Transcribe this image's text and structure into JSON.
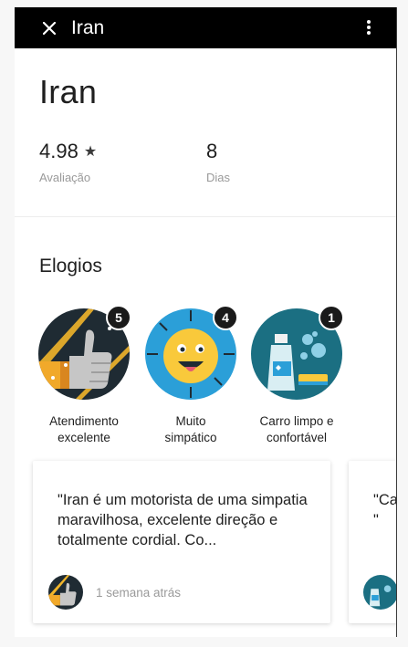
{
  "header": {
    "title": "Iran",
    "close_icon": "close-icon",
    "more_icon": "more-vertical-icon"
  },
  "profile": {
    "name": "Iran",
    "rating": {
      "value": "4.98",
      "icon": "star-icon",
      "label": "Avaliação"
    },
    "days": {
      "value": "8",
      "label": "Dias"
    }
  },
  "compliments": {
    "title": "Elogios",
    "items": [
      {
        "count": "5",
        "label_line1": "Atendimento",
        "label_line2": "excelente",
        "icon": "thumbs-up-icon",
        "bg": "#1f2b33"
      },
      {
        "count": "4",
        "label_line1": "Muito",
        "label_line2": "simpático",
        "icon": "smiley-face-icon",
        "bg": "#2b9fd8"
      },
      {
        "count": "1",
        "label_line1": "Carro limpo e",
        "label_line2": "confortável",
        "icon": "cleaning-spray-icon",
        "bg": "#1b6f82"
      }
    ]
  },
  "reviews": [
    {
      "text": "\"Iran é um motorista de uma simpatia maravilhosa, excelente direção e totalmente cordial. Co...",
      "time": "1 semana atrás",
      "avatar_icon": "thumbs-up-icon"
    },
    {
      "text": "\"Ca\n\"",
      "avatar_icon": "cleaning-spray-icon"
    }
  ],
  "colors": {
    "header_bg": "#000000",
    "badge_count_bg": "#1a1a1a",
    "muted_text": "#9a9a9a"
  }
}
